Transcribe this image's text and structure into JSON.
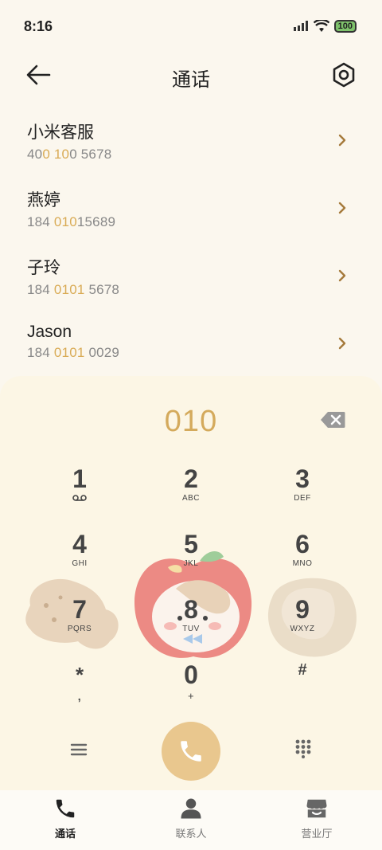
{
  "status_bar": {
    "time": "8:16",
    "battery": "100"
  },
  "header": {
    "title": "通话",
    "back_icon": "arrow-left-icon",
    "settings_icon": "gear-icon"
  },
  "results": [
    {
      "name": "小米客服",
      "number_parts": [
        "40",
        "0 10",
        "0 5678"
      ]
    },
    {
      "name": "燕婷",
      "number_parts": [
        "184 ",
        "010",
        "15689"
      ]
    },
    {
      "name": "子玲",
      "number_parts": [
        "184 ",
        "0101",
        " 5678"
      ]
    },
    {
      "name": "Jason",
      "number_parts": [
        "184 ",
        "0101",
        " 0029"
      ]
    }
  ],
  "dialer": {
    "input": "010",
    "keys": [
      {
        "digit": "1",
        "letters": ""
      },
      {
        "digit": "2",
        "letters": "ABC"
      },
      {
        "digit": "3",
        "letters": "DEF"
      },
      {
        "digit": "4",
        "letters": "GHI"
      },
      {
        "digit": "5",
        "letters": "JKL"
      },
      {
        "digit": "6",
        "letters": "MNO"
      },
      {
        "digit": "7",
        "letters": "PQRS"
      },
      {
        "digit": "8",
        "letters": "TUV"
      },
      {
        "digit": "9",
        "letters": "WXYZ"
      },
      {
        "digit": "*",
        "letters": ","
      },
      {
        "digit": "0",
        "letters": "+"
      },
      {
        "digit": "#",
        "letters": ""
      }
    ]
  },
  "bottom_nav": [
    {
      "label": "通话",
      "icon": "phone-icon",
      "active": true
    },
    {
      "label": "联系人",
      "icon": "person-icon",
      "active": false
    },
    {
      "label": "营业厅",
      "icon": "store-icon",
      "active": false
    }
  ],
  "colors": {
    "accent": "#d9ab55",
    "background": "#fbf7ee",
    "call_button": "#e9c78e"
  }
}
